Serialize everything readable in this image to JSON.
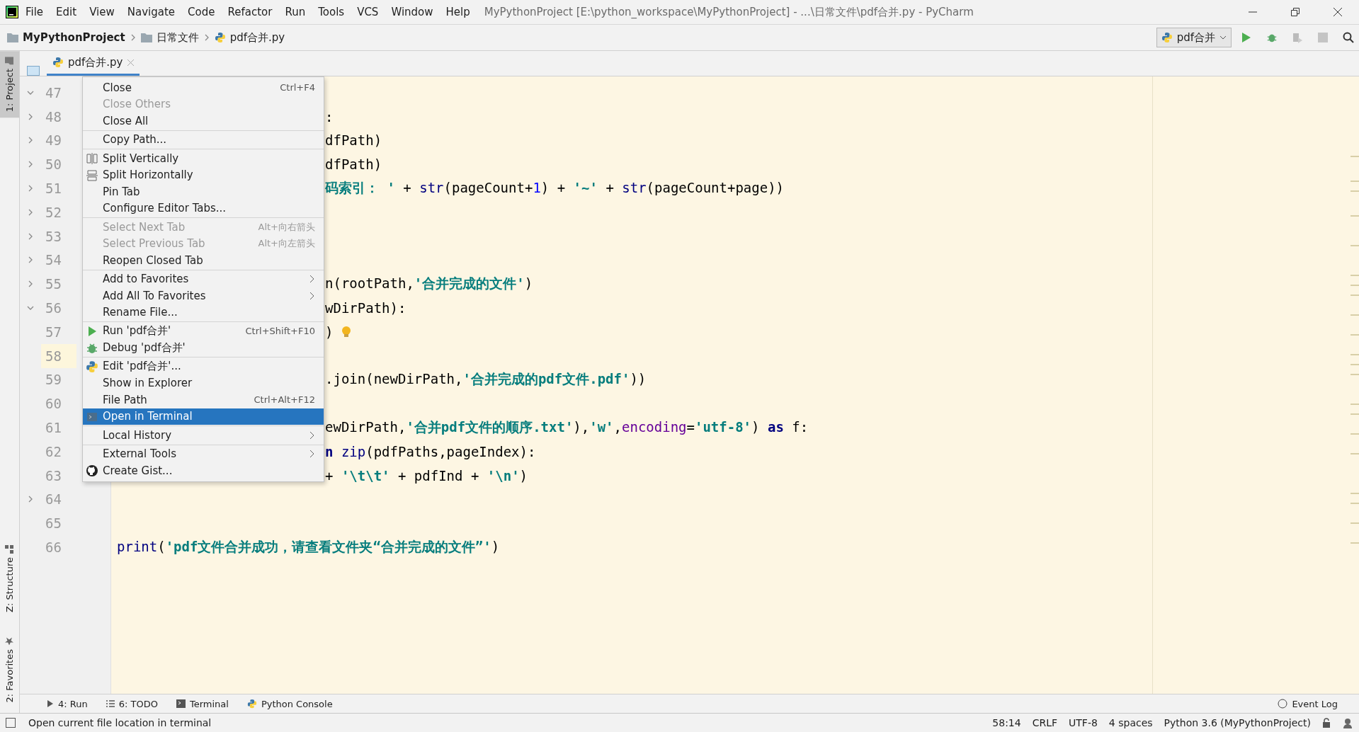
{
  "title_bar": {
    "menus": [
      "File",
      "Edit",
      "View",
      "Navigate",
      "Code",
      "Refactor",
      "Run",
      "Tools",
      "VCS",
      "Window",
      "Help"
    ],
    "title": "MyPythonProject [E:\\python_workspace\\MyPythonProject] - ...\\日常文件\\pdf合并.py - PyCharm"
  },
  "nav_bar": {
    "breadcrumbs": [
      {
        "label": "MyPythonProject",
        "kind": "project"
      },
      {
        "label": "日常文件",
        "kind": "folder"
      },
      {
        "label": "pdf合并.py",
        "kind": "file"
      }
    ],
    "run_config": "pdf合并"
  },
  "editor_tab": {
    "label": "pdf合并.py",
    "selected": true
  },
  "left_stripe": [
    {
      "label": "1: Project",
      "selected": true,
      "kind": "project"
    },
    {
      "label": "Z: Structure",
      "selected": false,
      "kind": "structure"
    },
    {
      "label": "2: Favorites",
      "selected": false,
      "kind": "favorites"
    }
  ],
  "editor": {
    "lines": [
      {
        "number": "47",
        "folded": false,
        "kind": "clipped",
        "current": false
      },
      {
        "number": "48",
        "folded": true,
        "kind": "clipped",
        "current": false,
        "tokens": [
          {
            "t": ":",
            "kind": "plain"
          }
        ]
      },
      {
        "number": "49",
        "folded": true,
        "kind": "clipped",
        "current": false,
        "tokens": [
          {
            "t": "dfPath)",
            "kind": "plain"
          }
        ]
      },
      {
        "number": "50",
        "folded": true,
        "kind": "clipped",
        "current": false,
        "tokens": [
          {
            "t": "dfPath)",
            "kind": "plain"
          }
        ]
      },
      {
        "number": "51",
        "folded": true,
        "kind": "clipped",
        "current": false,
        "tokens": [
          {
            "t": "码索引： '",
            "kind": "str"
          },
          {
            "t": " + ",
            "kind": "plain"
          },
          {
            "t": "str",
            "kind": "builtin"
          },
          {
            "t": "(pageCount+",
            "kind": "plain"
          },
          {
            "t": "1",
            "kind": "num"
          },
          {
            "t": ") + ",
            "kind": "plain"
          },
          {
            "t": "'~'",
            "kind": "str"
          },
          {
            "t": " + ",
            "kind": "plain"
          },
          {
            "t": "str",
            "kind": "builtin"
          },
          {
            "t": "(pageCount+page))",
            "kind": "plain"
          }
        ]
      },
      {
        "number": "52",
        "folded": true,
        "kind": "clipped",
        "current": false
      },
      {
        "number": "53",
        "folded": true,
        "kind": "clipped",
        "current": false
      },
      {
        "number": "54",
        "folded": true,
        "kind": "clipped",
        "current": false
      },
      {
        "number": "55",
        "folded": true,
        "kind": "clipped",
        "current": false,
        "tokens": [
          {
            "t": "n(rootPath,",
            "kind": "plain"
          },
          {
            "t": "'合并完成的文件'",
            "kind": "str"
          },
          {
            "t": ")",
            "kind": "plain"
          }
        ]
      },
      {
        "number": "56",
        "folded": false,
        "kind": "clipped",
        "current": false,
        "tokens": [
          {
            "t": "wDirPath):",
            "kind": "plain"
          }
        ]
      },
      {
        "number": "57",
        "kind": "clipped",
        "current": false,
        "bulb": true,
        "tokens": [
          {
            "t": ")",
            "kind": "plain"
          }
        ]
      },
      {
        "number": "58",
        "kind": "clipped",
        "current": true
      },
      {
        "number": "59",
        "kind": "clipped",
        "current": false,
        "tokens": [
          {
            "t": ".join(newDirPath,",
            "kind": "plain"
          },
          {
            "t": "'合并完成的pdf文件.pdf'",
            "kind": "str"
          },
          {
            "t": "))",
            "kind": "plain"
          }
        ]
      },
      {
        "number": "60",
        "kind": "clipped",
        "current": false
      },
      {
        "number": "61",
        "kind": "clipped",
        "current": false,
        "tokens": [
          {
            "t": "ewDirPath,",
            "kind": "plain"
          },
          {
            "t": "'合并pdf文件的顺序.txt'",
            "kind": "str"
          },
          {
            "t": "),",
            "kind": "plain"
          },
          {
            "t": "'w'",
            "kind": "str"
          },
          {
            "t": ",",
            "kind": "plain"
          },
          {
            "t": "encoding",
            "kind": "param"
          },
          {
            "t": "=",
            "kind": "plain"
          },
          {
            "t": "'utf-8'",
            "kind": "str"
          },
          {
            "t": ") ",
            "kind": "plain"
          },
          {
            "t": "as",
            "kind": "kw"
          },
          {
            "t": " f:",
            "kind": "plain"
          }
        ]
      },
      {
        "number": "62",
        "kind": "clipped",
        "current": false,
        "tokens": [
          {
            "t": "n",
            "kind": "kw"
          },
          {
            "t": " zip",
            "kind": "builtin"
          },
          {
            "t": "(pdfPaths,pageIndex):",
            "kind": "plain"
          }
        ]
      },
      {
        "number": "63",
        "kind": "clipped",
        "current": false,
        "tokens": [
          {
            "t": "+ ",
            "kind": "plain"
          },
          {
            "t": "'\\t\\t'",
            "kind": "str"
          },
          {
            "t": " + pdfInd + ",
            "kind": "plain"
          },
          {
            "t": "'\\n'",
            "kind": "str"
          },
          {
            "t": ")",
            "kind": "plain"
          }
        ]
      },
      {
        "number": "64",
        "folded": true,
        "kind": "clipped",
        "current": false
      },
      {
        "number": "65",
        "kind": "full",
        "current": false
      },
      {
        "number": "66",
        "kind": "full",
        "current": false,
        "tokens": [
          {
            "t": "print",
            "kind": "builtin"
          },
          {
            "t": "(",
            "kind": "plain"
          },
          {
            "t": "'pdf文件合并成功，请查看文件夹“合并完成的文件”'",
            "kind": "str"
          },
          {
            "t": ")",
            "kind": "plain"
          }
        ]
      }
    ]
  },
  "context_menu": {
    "groups": [
      [
        {
          "label": "Close",
          "shortcut": "Ctrl+F4",
          "disabled": false,
          "selected": false
        },
        {
          "label": "Close Others",
          "disabled": true,
          "selected": false
        },
        {
          "label": "Close All",
          "disabled": false,
          "selected": false
        }
      ],
      [
        {
          "label": "Copy Path...",
          "disabled": false,
          "selected": false
        }
      ],
      [
        {
          "label": "Split Vertically",
          "kind": "split-v",
          "disabled": false,
          "selected": false
        },
        {
          "label": "Split Horizontally",
          "kind": "split-h",
          "disabled": false,
          "selected": false
        },
        {
          "label": "Pin Tab",
          "disabled": false,
          "selected": false
        },
        {
          "label": "Configure Editor Tabs...",
          "disabled": false,
          "selected": false
        }
      ],
      [
        {
          "label": "Select Next Tab",
          "shortcut": "Alt+向右箭头",
          "disabled": true,
          "selected": false
        },
        {
          "label": "Select Previous Tab",
          "shortcut": "Alt+向左箭头",
          "disabled": true,
          "selected": false
        },
        {
          "label": "Reopen Closed Tab",
          "disabled": false,
          "selected": false
        }
      ],
      [
        {
          "label": "Add to Favorites",
          "submenu": true,
          "disabled": false,
          "selected": false
        },
        {
          "label": "Add All To Favorites",
          "submenu": true,
          "disabled": false,
          "selected": false
        },
        {
          "label": "Rename File...",
          "disabled": false,
          "selected": false
        }
      ],
      [
        {
          "label": "Run 'pdf合并'",
          "shortcut": "Ctrl+Shift+F10",
          "kind": "run",
          "disabled": false,
          "selected": false
        },
        {
          "label": "Debug 'pdf合并'",
          "kind": "debug",
          "disabled": false,
          "selected": false
        }
      ],
      [
        {
          "label": "Edit 'pdf合并'...",
          "kind": "python",
          "disabled": false,
          "selected": false
        },
        {
          "label": "Show in Explorer",
          "disabled": false,
          "selected": false
        },
        {
          "label": "File Path",
          "shortcut": "Ctrl+Alt+F12",
          "disabled": false,
          "selected": false
        },
        {
          "label": "Open in Terminal",
          "kind": "terminal",
          "disabled": false,
          "selected": true
        }
      ],
      [
        {
          "label": "Local History",
          "submenu": true,
          "disabled": false,
          "selected": false
        }
      ],
      [
        {
          "label": "External Tools",
          "submenu": true,
          "disabled": false,
          "selected": false
        },
        {
          "label": "Create Gist...",
          "kind": "github",
          "disabled": false,
          "selected": false
        }
      ]
    ]
  },
  "tool_bar": {
    "tools": [
      {
        "label": "4: Run",
        "kind": "run"
      },
      {
        "label": "6: TODO",
        "kind": "todo"
      },
      {
        "label": "Terminal",
        "kind": "terminal"
      },
      {
        "label": "Python Console",
        "kind": "python"
      }
    ],
    "event_log": "Event Log"
  },
  "status_bar": {
    "message": "Open current file location in terminal",
    "items": [
      "58:14",
      "CRLF",
      "UTF-8",
      "4 spaces",
      "Python 3.6 (MyPythonProject)"
    ]
  }
}
